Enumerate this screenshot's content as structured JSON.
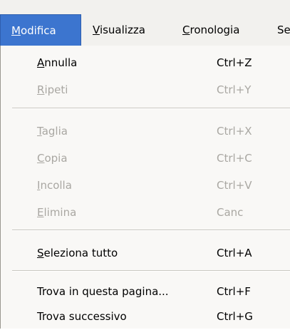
{
  "menubar": {
    "items": [
      {
        "label": "Modifica",
        "active": true
      },
      {
        "label": "Visualizza",
        "active": false
      },
      {
        "label": "Cronologia",
        "active": false
      },
      {
        "label": "Se",
        "active": false
      }
    ]
  },
  "menu": {
    "items": [
      {
        "label": "Annulla",
        "shortcut": "Ctrl+Z",
        "enabled": true
      },
      {
        "label": "Ripeti",
        "shortcut": "Ctrl+Y",
        "enabled": false
      },
      {
        "label": "Taglia",
        "shortcut": "Ctrl+X",
        "enabled": false
      },
      {
        "label": "Copia",
        "shortcut": "Ctrl+C",
        "enabled": false
      },
      {
        "label": "Incolla",
        "shortcut": "Ctrl+V",
        "enabled": false
      },
      {
        "label": "Elimina",
        "shortcut": "Canc",
        "enabled": false
      },
      {
        "label": "Seleziona tutto",
        "shortcut": "Ctrl+A",
        "enabled": true
      },
      {
        "label": "Trova in questa pagina...",
        "shortcut": "Ctrl+F",
        "enabled": true
      },
      {
        "label": "Trova successivo",
        "shortcut": "Ctrl+G",
        "enabled": true
      }
    ]
  },
  "colors": {
    "active_menu_bg": "#3c75cf",
    "disabled_text": "#a9a7a2",
    "menu_bg": "#f9f8f6"
  }
}
